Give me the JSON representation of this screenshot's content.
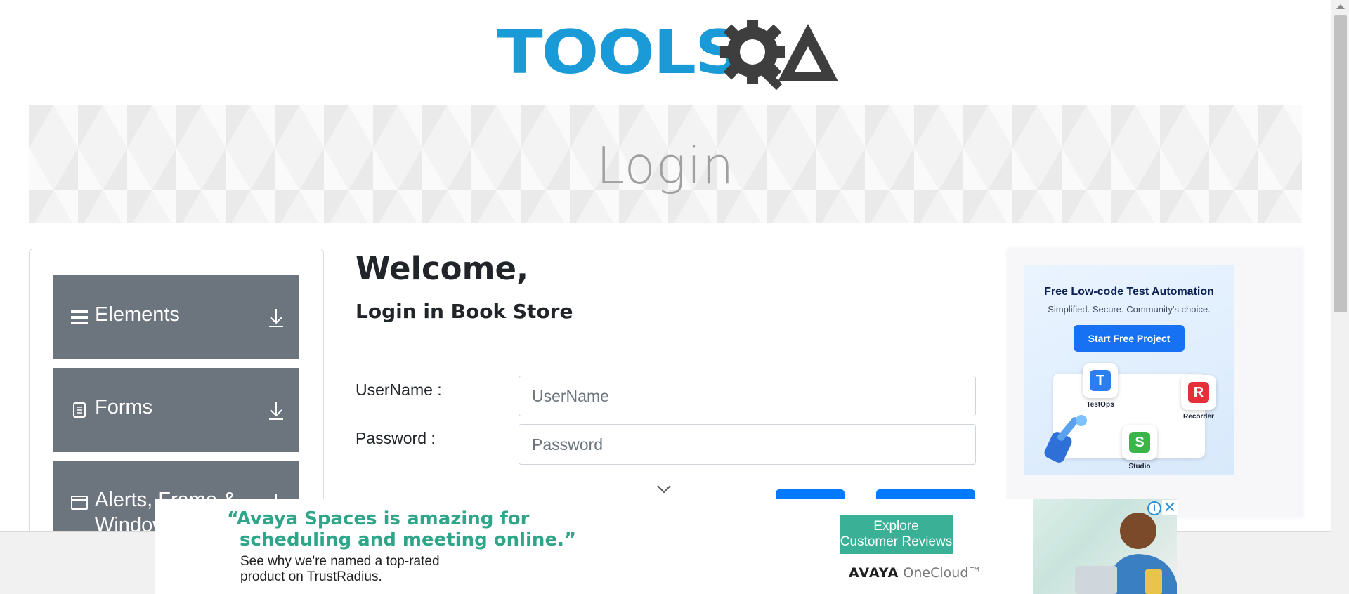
{
  "header": {
    "logo_text": "TOOLS",
    "logo_suffix": "A"
  },
  "banner": {
    "title": "Login"
  },
  "sidebar": {
    "groups": [
      {
        "label": "Elements",
        "icon": "hamburger-icon"
      },
      {
        "label": "Forms",
        "icon": "document-icon"
      },
      {
        "label": "Alerts, Frame & Windows",
        "icon": "window-icon"
      }
    ]
  },
  "main": {
    "welcome": "Welcome,",
    "subtitle": "Login in Book Store",
    "username_label": "UserName :",
    "username_placeholder": "UserName",
    "password_label": "Password :",
    "password_placeholder": "Password"
  },
  "side_ad": {
    "title": "Free Low-code Test Automation",
    "subtitle": "Simplified. Secure. Community's choice.",
    "cta": "Start Free Project",
    "apps": [
      {
        "name": "TestOps",
        "glyph": "T",
        "color": "#2b7ef0"
      },
      {
        "name": "Recorder",
        "glyph": "R",
        "color": "#e5303a"
      },
      {
        "name": "Studio",
        "glyph": "S",
        "color": "#39b54a"
      }
    ]
  },
  "bottom_ad": {
    "quote_line1": "“Avaya Spaces is amazing for",
    "quote_line2": "scheduling and meeting online.”",
    "desc_line1": "See why we're named a top-rated",
    "desc_line2": "product on TrustRadius.",
    "cta_line1": "Explore",
    "cta_line2": "Customer Reviews",
    "brand": "AVAYA",
    "brand_suffix": "OneCloud™",
    "info": "i",
    "close": "✕"
  },
  "colors": {
    "brand_blue": "#1a9bd7",
    "menu_bg": "#6c757d",
    "primary": "#007bff",
    "ad_green": "#3ab197"
  }
}
